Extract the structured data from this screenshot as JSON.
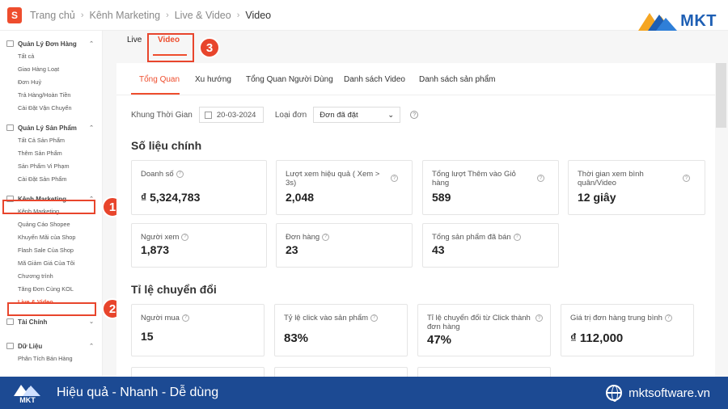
{
  "header": {
    "breadcrumb": [
      "Trang chủ",
      "Kênh Marketing",
      "Live & Video",
      "Video"
    ],
    "logo_letter": "S",
    "brand": "MKT",
    "sep": "›"
  },
  "sidebar": {
    "groups": [
      {
        "title": "Quản Lý Đơn Hàng",
        "items": [
          "Tất cả",
          "Giao Hàng Loạt",
          "Đơn Huỷ",
          "Trả Hàng/Hoàn Tiền",
          "Cài Đặt Vận Chuyển"
        ]
      },
      {
        "title": "Quản Lý Sản Phẩm",
        "items": [
          "Tất Cả Sản Phẩm",
          "Thêm Sản Phẩm",
          "Sản Phẩm Vi Phạm",
          "Cài Đặt Sản Phẩm"
        ]
      },
      {
        "title": "Kênh Marketing",
        "items": [
          "Kênh Marketing",
          "Quảng Cáo Shopee",
          "Khuyến Mãi của Shop",
          "Flash Sale Của Shop",
          "Mã Giảm Giá Của Tôi",
          "Chương trình",
          "Tăng Đơn Cùng KOL",
          "Live & Video"
        ]
      },
      {
        "title": "Tài Chính",
        "items": []
      },
      {
        "title": "Dữ Liệu",
        "items": [
          "Phân Tích Bán Hàng"
        ]
      }
    ],
    "chevron_up": "⌃",
    "chevron_down": "⌄"
  },
  "subtabs": [
    "Live",
    "Video"
  ],
  "tabs": [
    "Tổng Quan",
    "Xu hướng",
    "Tổng Quan Người Dùng",
    "Danh sách Video",
    "Danh sách sản phẩm"
  ],
  "filters": {
    "time_label": "Khung Thời Gian",
    "date": "20-03-2024",
    "order_label": "Loại đơn",
    "order_value": "Đơn đã đặt",
    "dropdown_arrow": "⌄",
    "help": "?"
  },
  "sections": {
    "main": "Số liệu chính",
    "conversion": "Tỉ lệ chuyển đổi"
  },
  "main_metrics": [
    {
      "label": "Doanh số",
      "value": "₫ 5,324,783"
    },
    {
      "label": "Lượt xem hiệu quả ( Xem > 3s)",
      "value": "2,048"
    },
    {
      "label": "Tổng lượt Thêm vào Giỏ hàng",
      "value": "589"
    },
    {
      "label": "Thời gian xem bình quân/Video",
      "value": "12 giây"
    },
    {
      "label": "Người xem",
      "value": "1,873"
    },
    {
      "label": "Đơn hàng",
      "value": "23"
    },
    {
      "label": "Tổng sản phẩm đã bán",
      "value": "43"
    }
  ],
  "conversion_metrics": [
    {
      "label": "Người mua",
      "value": "15"
    },
    {
      "label": "Tỷ lệ click vào sản phẩm",
      "value": "83%"
    },
    {
      "label": "Tỉ lệ chuyển đổi từ Click thành đơn hàng",
      "value": "47%"
    },
    {
      "label": "Giá trị đơn hàng trung bình",
      "value": "₫ 112,000"
    }
  ],
  "badges": [
    "1",
    "2",
    "3"
  ],
  "footer": {
    "logo_text": "MKT",
    "slogan": "Hiệu quả - Nhanh - Dễ dùng",
    "site": "mktsoftware.vn"
  },
  "colors": {
    "accent": "#ee4d2d",
    "highlight": "#e8452c",
    "footer": "#1c4a93",
    "brand_blue": "#1e5fb4"
  }
}
